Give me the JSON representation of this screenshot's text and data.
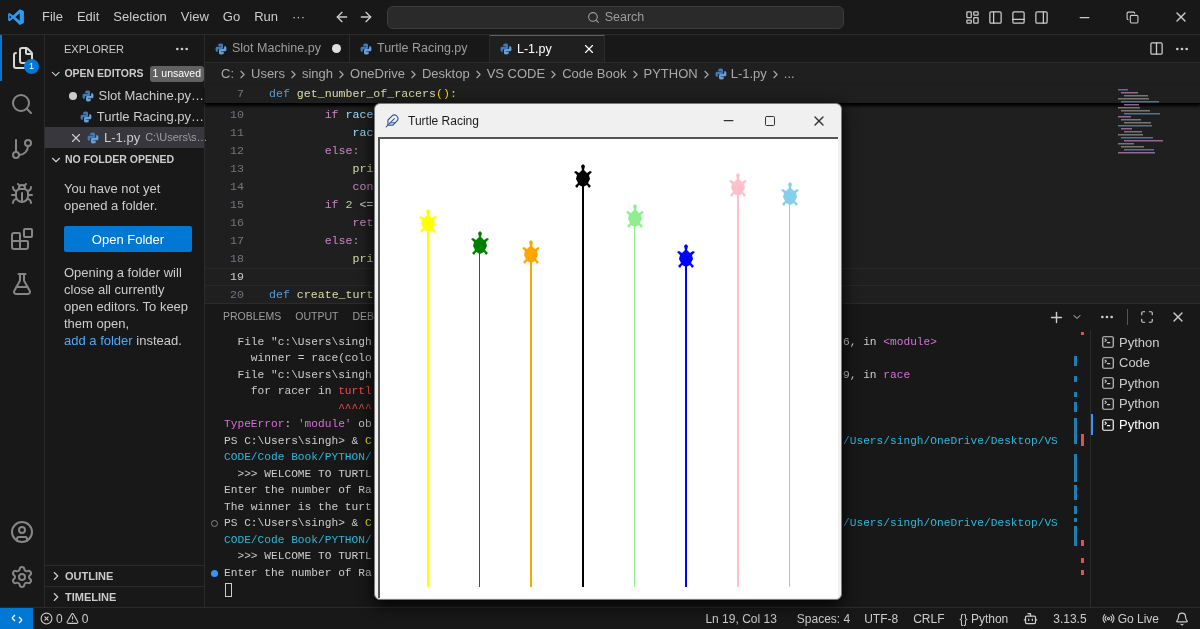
{
  "title_bar": {
    "menus": [
      "File",
      "Edit",
      "Selection",
      "View",
      "Go",
      "Run",
      "···"
    ],
    "search": "Search"
  },
  "activity_bar": {
    "explorer_badge": "1"
  },
  "sidebar": {
    "title": "EXPLORER",
    "open_editors": {
      "title": "OPEN EDITORS",
      "badge": "1 unsaved",
      "expanded": true,
      "items": [
        {
          "name": "Slot Machine.py…",
          "dirty": true,
          "selected": false
        },
        {
          "name": "Turtle Racing.py…",
          "dirty": false,
          "selected": false
        },
        {
          "name": "L-1.py",
          "description": "C:\\Users\\s…",
          "dirty": false,
          "selected": true
        }
      ]
    },
    "folder_section": {
      "title": "NO FOLDER OPENED",
      "expanded": true,
      "message": "You have not yet opened a folder.",
      "button": "Open Folder",
      "note": "Opening a folder will close all currently open editors. To keep them open,",
      "link": "add a folder",
      "note_end": "instead."
    },
    "collapsed_sections": [
      {
        "title": "OUTLINE",
        "expanded": false
      },
      {
        "title": "TIMELINE",
        "expanded": false
      }
    ]
  },
  "tabs": [
    {
      "label": "Slot Machine.py",
      "dirty": true,
      "selected": false
    },
    {
      "label": "Turtle Racing.py",
      "dirty": false,
      "selected": false
    },
    {
      "label": "L-1.py",
      "dirty": false,
      "selected": true
    }
  ],
  "breadcrumb": [
    {
      "label": "C:",
      "kind": "folder"
    },
    {
      "label": "Users",
      "kind": "folder"
    },
    {
      "label": "singh",
      "kind": "folder"
    },
    {
      "label": "OneDrive",
      "kind": "folder"
    },
    {
      "label": "Desktop",
      "kind": "folder"
    },
    {
      "label": "VS CODE",
      "kind": "folder"
    },
    {
      "label": "Code Book",
      "kind": "folder"
    },
    {
      "label": "PYTHON",
      "kind": "folder"
    },
    {
      "label": "L-1.py",
      "kind": "file"
    },
    {
      "label": "...",
      "kind": "more"
    }
  ],
  "sticky_line": {
    "number": "7",
    "segments": [
      {
        "text": "def ",
        "kind": "keyword"
      },
      {
        "text": "get_number_of_racers",
        "kind": "function"
      },
      {
        "text": "():",
        "kind": "bracket"
      }
    ]
  },
  "code_lines": [
    {
      "number": "10",
      "current": false,
      "segments": [
        {
          "text": "        if ",
          "kind": "control"
        },
        {
          "text": "race",
          "kind": "variable"
        }
      ]
    },
    {
      "number": "11",
      "current": false,
      "segments": [
        {
          "text": "            rac",
          "kind": "variable"
        }
      ]
    },
    {
      "number": "12",
      "current": false,
      "segments": [
        {
          "text": "        else:",
          "kind": "control"
        }
      ]
    },
    {
      "number": "13",
      "current": false,
      "segments": [
        {
          "text": "            pri",
          "kind": "function"
        }
      ]
    },
    {
      "number": "14",
      "current": false,
      "segments": [
        {
          "text": "            con",
          "kind": "control"
        }
      ]
    },
    {
      "number": "15",
      "current": false,
      "segments": [
        {
          "text": "        if ",
          "kind": "control"
        },
        {
          "text": "2 ",
          "kind": "number"
        },
        {
          "text": "<=",
          "kind": "plain"
        }
      ]
    },
    {
      "number": "16",
      "current": false,
      "segments": [
        {
          "text": "            ret",
          "kind": "control"
        }
      ]
    },
    {
      "number": "17",
      "current": false,
      "segments": [
        {
          "text": "        else:",
          "kind": "control"
        }
      ]
    },
    {
      "number": "18",
      "current": false,
      "segments": [
        {
          "text": "            pri",
          "kind": "function"
        }
      ]
    },
    {
      "number": "19",
      "current": true
    },
    {
      "number": "20",
      "current": false,
      "segments": [
        {
          "text": "def ",
          "kind": "keyword"
        },
        {
          "text": "create_turt",
          "kind": "function"
        }
      ]
    }
  ],
  "panel": {
    "tabs": [
      {
        "label": "PROBLEMS",
        "selected": false
      },
      {
        "label": "OUTPUT",
        "selected": false
      },
      {
        "label": "DEB",
        "selected": false
      }
    ],
    "terminal_lines": [
      {
        "kind": "output",
        "left": [
          {
            "text": "  File \"c:\\Users\\singh",
            "kind": "plain"
          }
        ],
        "right": [
          {
            "text": "6, in ",
            "kind": "plain"
          },
          {
            "text": "<module>",
            "kind": "magenta"
          }
        ]
      },
      {
        "kind": "output",
        "left": [
          {
            "text": "    winner = race(colo",
            "kind": "plain"
          }
        ]
      },
      {
        "kind": "output",
        "left": [
          {
            "text": "  File \"c:\\Users\\singh",
            "kind": "plain"
          }
        ],
        "right": [
          {
            "text": "9, in ",
            "kind": "plain"
          },
          {
            "text": "race",
            "kind": "magenta"
          }
        ]
      },
      {
        "kind": "output",
        "left": [
          {
            "text": "    for racer in ",
            "kind": "plain"
          },
          {
            "text": "turtl",
            "kind": "red"
          }
        ]
      },
      {
        "kind": "output",
        "left": [
          {
            "text": "                 ^^^^^",
            "kind": "red"
          }
        ]
      },
      {
        "kind": "output",
        "left": [
          {
            "text": "TypeError",
            "kind": "magenta"
          },
          {
            "text": ": ",
            "kind": "plain"
          },
          {
            "text": "'module'",
            "kind": "magenta"
          },
          {
            "text": " ob",
            "kind": "plain"
          }
        ]
      },
      {
        "kind": "output",
        "left": [
          {
            "text": "PS C:\\Users\\singh> & ",
            "kind": "plain"
          },
          {
            "text": "C",
            "kind": "yellow"
          }
        ],
        "right": [
          {
            "text": "/Users/singh/OneDrive/Desktop/VS",
            "kind": "cyan"
          }
        ]
      },
      {
        "kind": "output",
        "left": [
          {
            "text": "CODE/Code Book/PYTHON/",
            "kind": "cyan"
          }
        ]
      },
      {
        "kind": "output",
        "left": [
          {
            "text": "  >>> WELCOME TO TURTL",
            "kind": "plain"
          }
        ]
      },
      {
        "kind": "output",
        "left": [
          {
            "text": "Enter the number of Ra",
            "kind": "plain"
          }
        ]
      },
      {
        "kind": "output",
        "left": [
          {
            "text": "The winner is the turt",
            "kind": "plain"
          }
        ]
      },
      {
        "kind": "finished_command",
        "left": [
          {
            "text": "PS C:\\Users\\singh> & ",
            "kind": "plain"
          },
          {
            "text": "C",
            "kind": "yellow"
          }
        ],
        "right": [
          {
            "text": "/Users/singh/OneDrive/Desktop/VS",
            "kind": "cyan"
          }
        ]
      },
      {
        "kind": "output",
        "left": [
          {
            "text": "CODE/Code Book/PYTHON/",
            "kind": "cyan"
          }
        ]
      },
      {
        "kind": "output",
        "left": [
          {
            "text": "  >>> WELCOME TO TURTL",
            "kind": "plain"
          }
        ]
      },
      {
        "kind": "running_command",
        "left": [
          {
            "text": "Enter the number of Ra",
            "kind": "plain"
          }
        ]
      }
    ],
    "cursor_visible": true,
    "terminals": [
      {
        "label": "Python",
        "selected": false
      },
      {
        "label": "Code",
        "selected": false
      },
      {
        "label": "Python",
        "selected": false
      },
      {
        "label": "Python",
        "selected": false
      },
      {
        "label": "Python",
        "selected": true
      }
    ]
  },
  "status_bar": {
    "errors": "0",
    "warnings": "0",
    "cursor_position": "Ln 19, Col 13",
    "indentation": "Spaces: 4",
    "encoding": "UTF-8",
    "line_endings": "CRLF",
    "language": "{} Python",
    "python_version": "3.13.5",
    "live_server": "Go Live"
  },
  "turtle_window": {
    "title": "Turtle Racing",
    "racers": [
      {
        "color": "#ffff00"
      },
      {
        "color": "#008000"
      },
      {
        "color": "#ffa500"
      },
      {
        "color": "#000000"
      },
      {
        "color": "#90ee90"
      },
      {
        "color": "#0000ff"
      },
      {
        "color": "#ffc0cb"
      },
      {
        "color": "#87ceeb"
      }
    ]
  }
}
